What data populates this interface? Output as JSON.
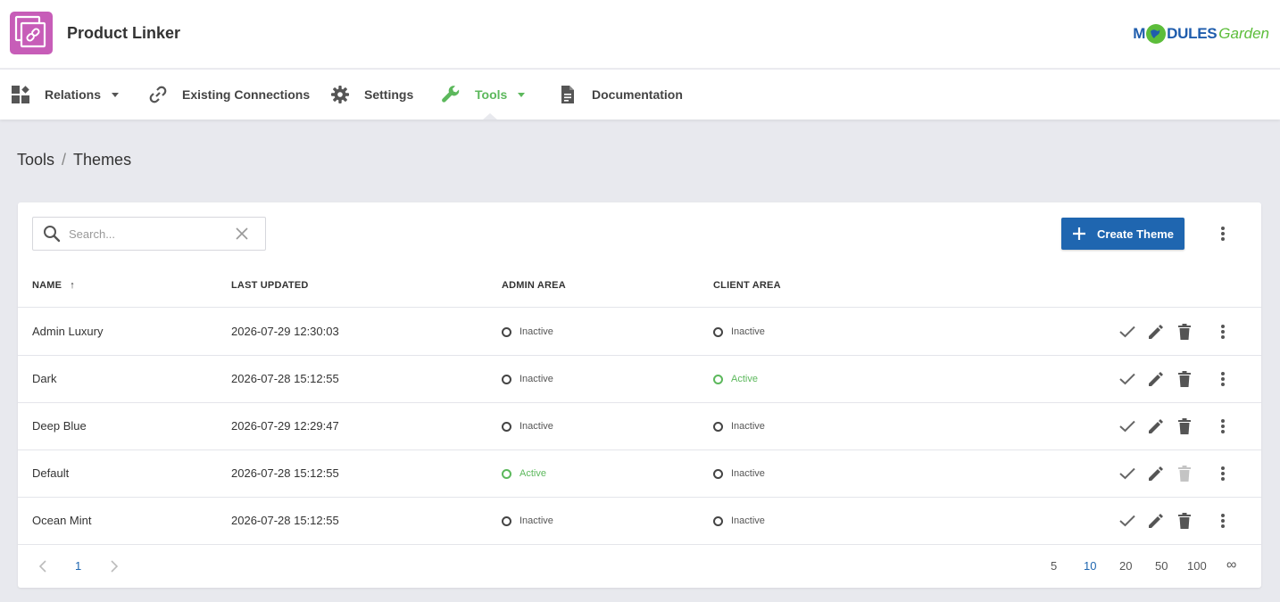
{
  "app": {
    "title": "Product Linker",
    "brand_part1": "M",
    "brand_part2": "DULES",
    "brand_part3": "Garden"
  },
  "nav": [
    {
      "label": "Relations",
      "icon": "widgets-icon",
      "dropdown": true
    },
    {
      "label": "Existing Connections",
      "icon": "link-icon",
      "dropdown": false
    },
    {
      "label": "Settings",
      "icon": "gear-icon",
      "dropdown": false
    },
    {
      "label": "Tools",
      "icon": "wrench-icon",
      "dropdown": true,
      "active": true
    },
    {
      "label": "Documentation",
      "icon": "document-icon",
      "dropdown": false
    }
  ],
  "breadcrumb": {
    "parent": "Tools",
    "separator": "/",
    "current": "Themes"
  },
  "search": {
    "placeholder": "Search...",
    "value": ""
  },
  "create_button": {
    "label": "Create Theme"
  },
  "table": {
    "columns": [
      {
        "label": "NAME",
        "sort": "↑"
      },
      {
        "label": "LAST UPDATED"
      },
      {
        "label": "ADMIN AREA"
      },
      {
        "label": "CLIENT AREA"
      }
    ],
    "rows": [
      {
        "name": "Admin Luxury",
        "updated": "2026-07-29 12:30:03",
        "admin": "Inactive",
        "client": "Inactive",
        "delete_enabled": true
      },
      {
        "name": "Dark",
        "updated": "2026-07-28 15:12:55",
        "admin": "Inactive",
        "client": "Active",
        "delete_enabled": true
      },
      {
        "name": "Deep Blue",
        "updated": "2026-07-29 12:29:47",
        "admin": "Inactive",
        "client": "Inactive",
        "delete_enabled": true
      },
      {
        "name": "Default",
        "updated": "2026-07-28 15:12:55",
        "admin": "Active",
        "client": "Inactive",
        "delete_enabled": false
      },
      {
        "name": "Ocean Mint",
        "updated": "2026-07-28 15:12:55",
        "admin": "Inactive",
        "client": "Inactive",
        "delete_enabled": true
      }
    ]
  },
  "pagination": {
    "current_page": "1",
    "page_sizes": [
      "5",
      "10",
      "20",
      "50",
      "100",
      "∞"
    ],
    "selected_size": "10"
  },
  "colors": {
    "accent_green": "#5cb85c",
    "primary_blue": "#1f66b0",
    "logo_pink": "#c75db8"
  }
}
